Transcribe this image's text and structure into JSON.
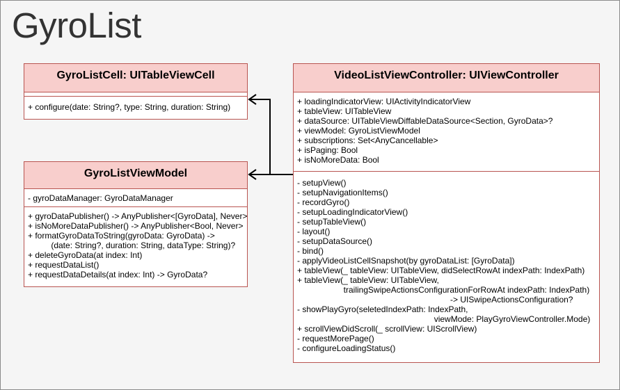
{
  "diagram": {
    "title": "GyroList",
    "classes": [
      {
        "id": "cell",
        "name": "GyroListCell: UITableViewCell",
        "attributes": [],
        "methods": [
          "+ configure(date: String?, type: String, duration: String)"
        ]
      },
      {
        "id": "viewmodel",
        "name": "GyroListViewModel",
        "attributes": [
          "- gyroDataManager: GyroDataManager"
        ],
        "methods": [
          "+ gyroDataPublisher() -> AnyPublisher<[GyroData], Never>",
          "+ isNoMoreDataPublisher() -> AnyPublisher<Bool, Never>",
          "+ formatGyroDataToString(gyroData: GyroData) ->",
          "          (date: String?, duration: String, dataType: String)?",
          "+ deleteGyroData(at index: Int)",
          "+ requestDataList()",
          "+ requestDataDetails(at index: Int) -> GyroData?"
        ]
      },
      {
        "id": "controller",
        "name": "VideoListViewController: UIViewController",
        "attributes": [
          "+ loadingIndicatorView: UIActivityIndicatorView",
          "+ tableView: UITableView",
          "+ dataSource: UITableViewDiffableDataSource<Section, GyroData>?",
          "+ viewModel: GyroListViewModel",
          "+ subscriptions: Set<AnyCancellable>",
          "+ isPaging: Bool",
          "+ isNoMoreData: Bool"
        ],
        "methods": [
          "- setupView()",
          "- setupNavigationItems()",
          "- recordGyro()",
          "- setupLoadingIndicatorView()",
          "- setupTableView()",
          "- layout()",
          "- setupDataSource()",
          "- bind()",
          "- applyVideoListCellSnapshot(by gyroDataList: [GyroData])",
          "+ tableView(_ tableView: UITableView, didSelectRowAt indexPath: IndexPath)",
          "+ tableView(_ tableView: UITableView,",
          "                    trailingSwipeActionsConfigurationForRowAt indexPath: IndexPath)",
          "                                                                  -> UISwipeActionsConfiguration?",
          "- showPlayGyro(seletedIndexPath: IndexPath,",
          "                                                           viewMode: PlayGyroViewController.Mode)",
          "+ scrollViewDidScroll(_ scrollView: UIScrollView)",
          "- requestMorePage()",
          "- configureLoadingStatus()"
        ]
      }
    ],
    "relations": [
      {
        "from": "controller",
        "to": "cell",
        "kind": "association"
      },
      {
        "from": "controller",
        "to": "viewmodel",
        "kind": "association"
      }
    ]
  }
}
